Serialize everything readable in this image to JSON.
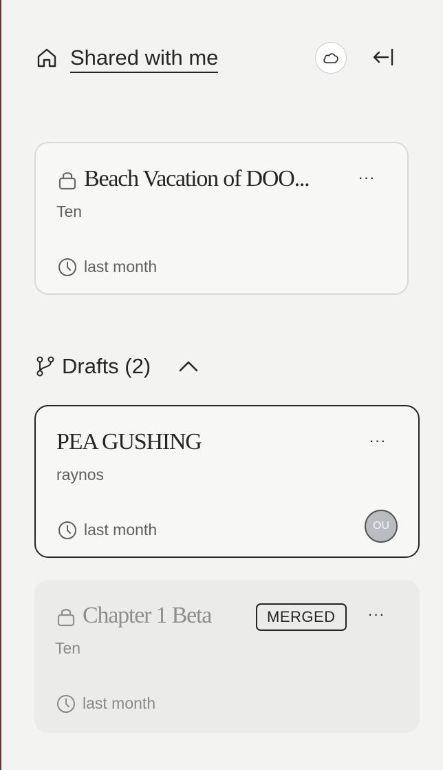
{
  "header": {
    "title": "Shared with me",
    "home_icon": "home-icon",
    "cloud_icon": "cloud-icon",
    "collapse_icon": "collapse-left-icon"
  },
  "shared_doc": {
    "title": "Beach Vacation of DOO...",
    "owner": "Ten",
    "time": "last month",
    "locked": true,
    "more_label": "···"
  },
  "drafts": {
    "label": "Drafts (2)",
    "expanded": true,
    "items": [
      {
        "title": "PEA GUSHING",
        "owner": "raynos",
        "time": "last month",
        "avatar": "OU",
        "more_label": "···"
      },
      {
        "title": "Chapter 1 Beta",
        "owner": "Ten",
        "time": "last month",
        "badge": "MERGED",
        "locked": true,
        "more_label": "···"
      }
    ]
  },
  "colors": {
    "background": "#f3f3f1",
    "card": "#f7f7f6",
    "merged_card": "#ebebe9",
    "text": "#262626",
    "muted_text": "#8e8e8c",
    "avatar": "#b9bcc0"
  }
}
